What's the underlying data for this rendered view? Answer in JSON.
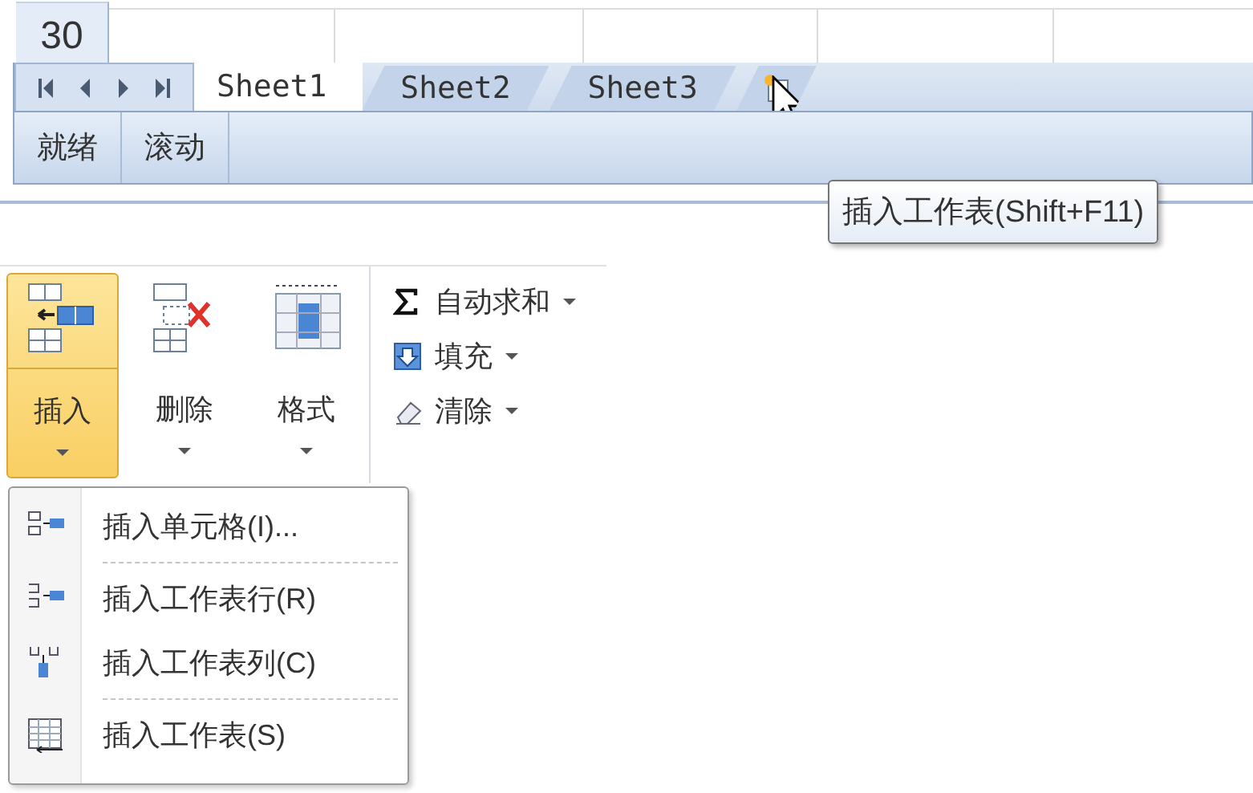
{
  "sheet": {
    "row_number": "30",
    "tabs": [
      {
        "label": "Sheet1",
        "selected": true
      },
      {
        "label": "Sheet2",
        "selected": false
      },
      {
        "label": "Sheet3",
        "selected": false
      }
    ],
    "status_bar": {
      "items": [
        "就绪",
        "滚动"
      ]
    },
    "tooltip": "插入工作表(Shift+F11)"
  },
  "ribbon": {
    "large_buttons": [
      {
        "label": "插入",
        "kind": "insert",
        "selected": true
      },
      {
        "label": "删除",
        "kind": "delete",
        "selected": false
      },
      {
        "label": "格式",
        "kind": "format",
        "selected": false
      }
    ],
    "small_buttons": [
      {
        "label": "自动求和",
        "kind": "sum"
      },
      {
        "label": "填充",
        "kind": "fill"
      },
      {
        "label": "清除",
        "kind": "clear"
      }
    ]
  },
  "menu": {
    "groups": [
      [
        {
          "label": "插入单元格(I)...",
          "kind": "cells"
        }
      ],
      [
        {
          "label": "插入工作表行(R)",
          "kind": "rows"
        },
        {
          "label": "插入工作表列(C)",
          "kind": "columns"
        }
      ],
      [
        {
          "label": "插入工作表(S)",
          "kind": "sheet"
        }
      ]
    ]
  }
}
